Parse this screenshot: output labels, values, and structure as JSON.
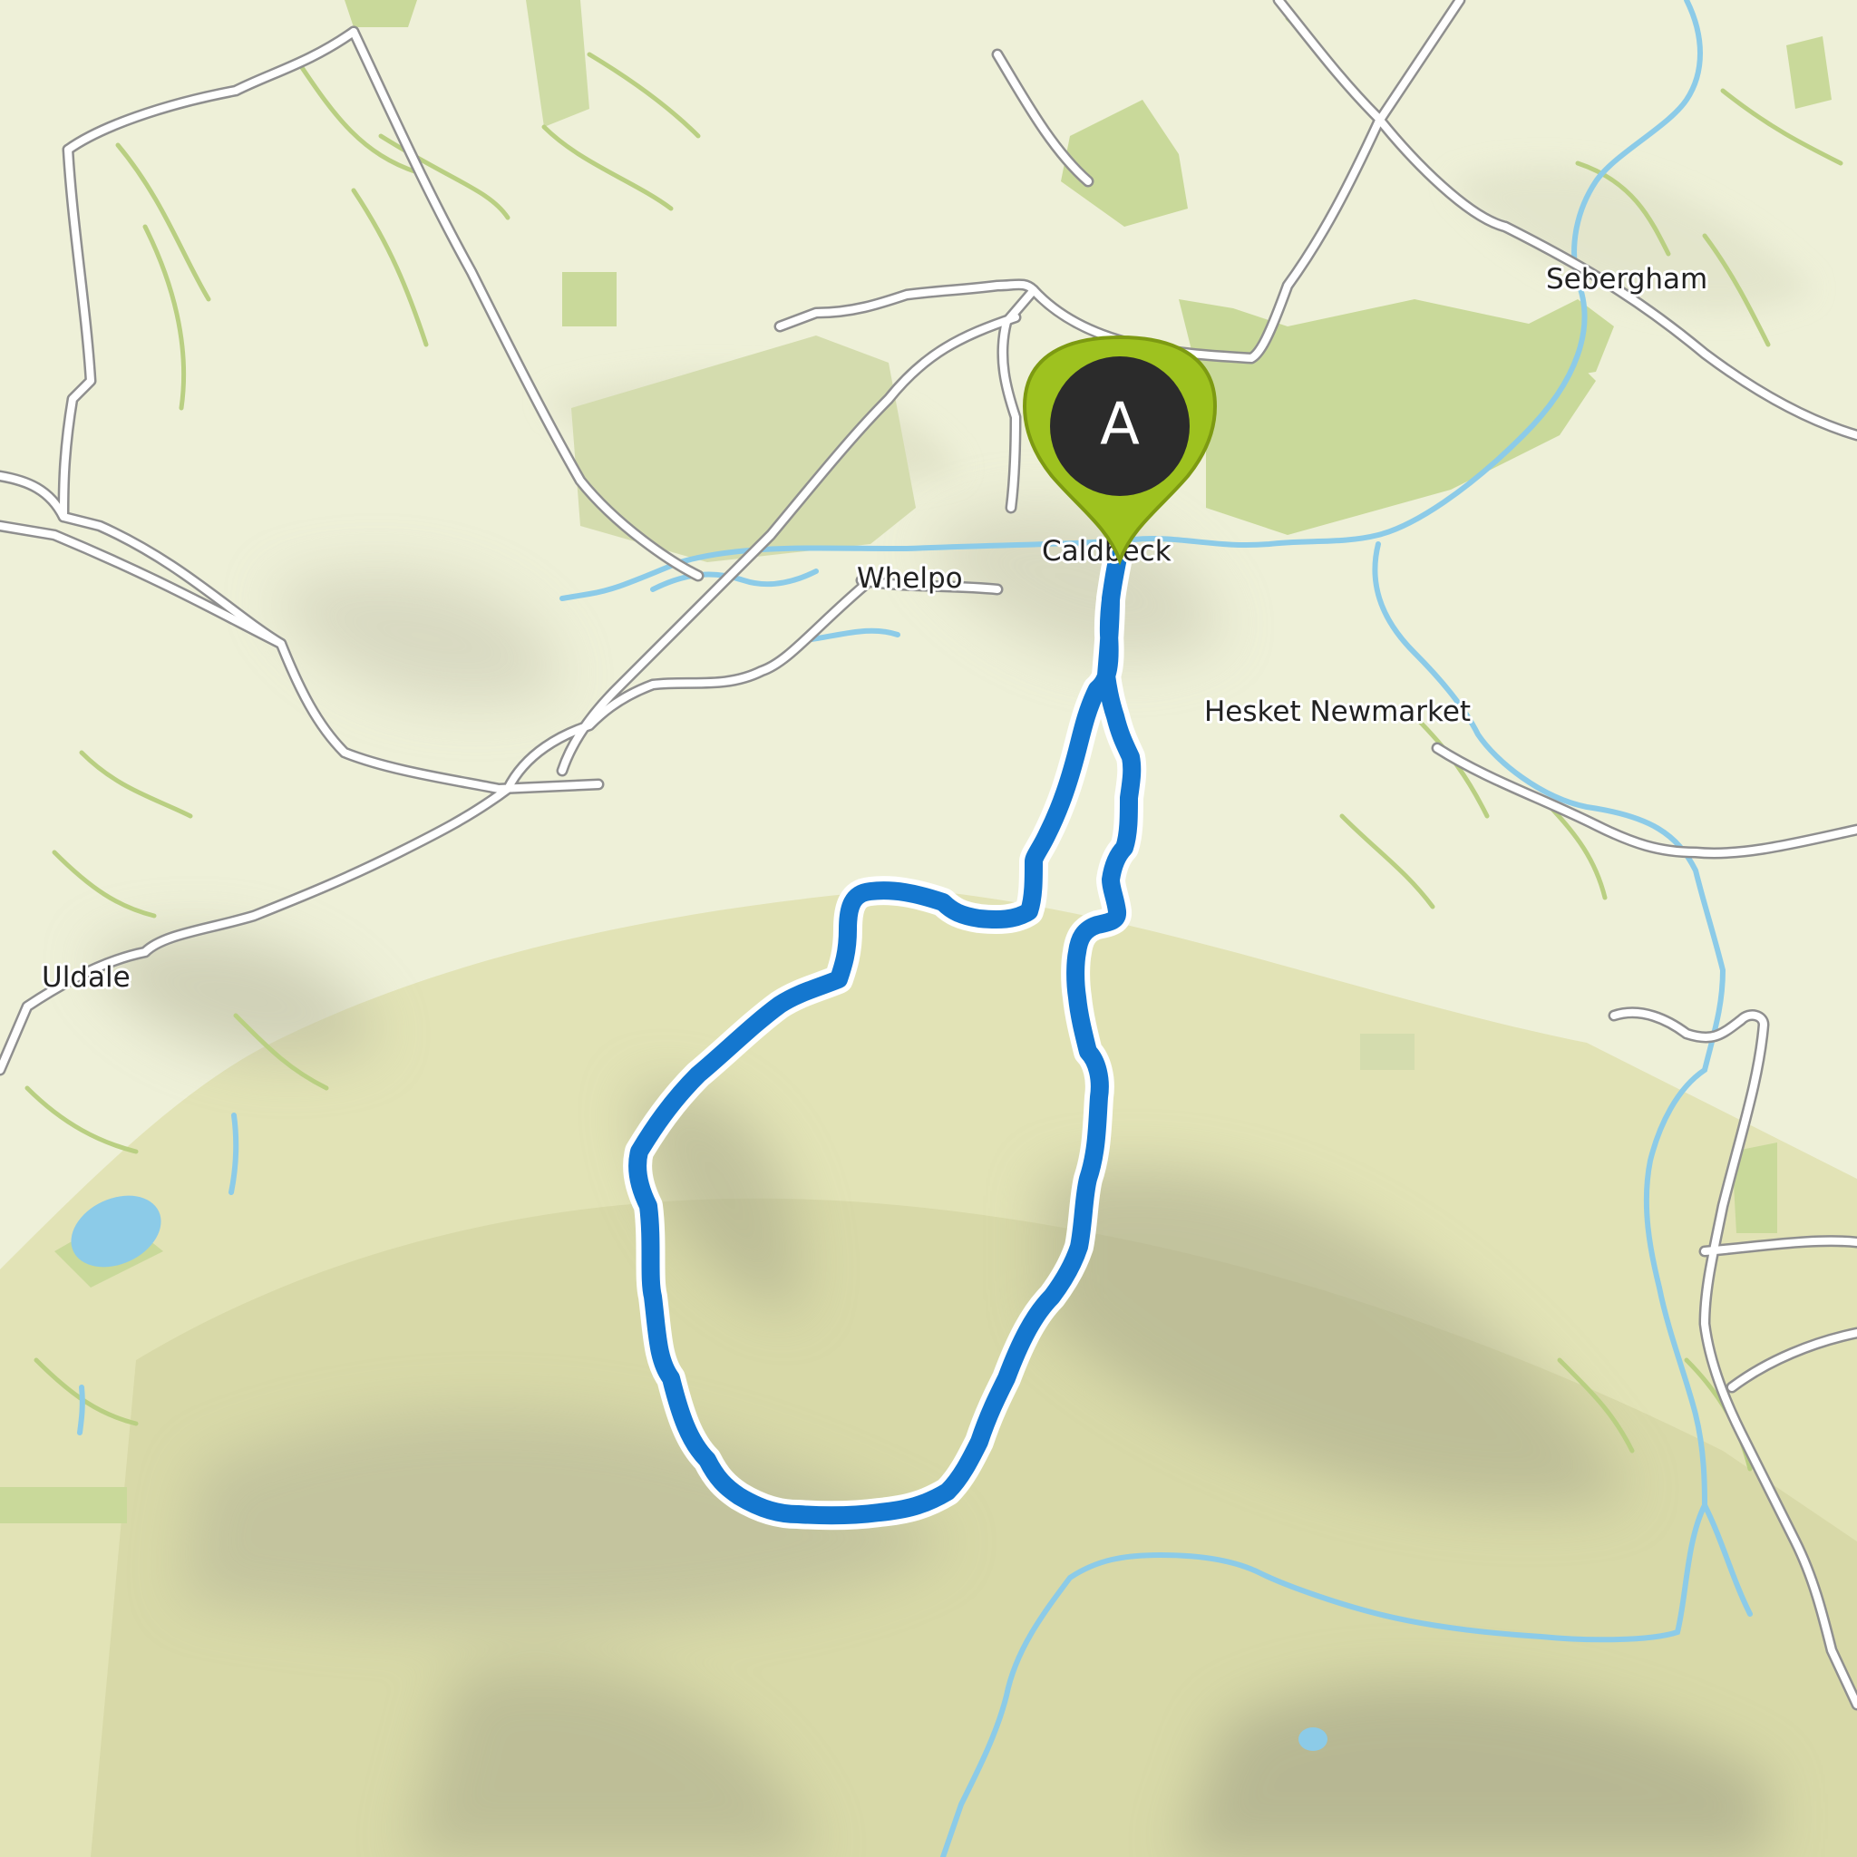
{
  "map": {
    "places": [
      {
        "id": "sebergham",
        "label": "Sebergham"
      },
      {
        "id": "caldbeck",
        "label": "Caldbeck"
      },
      {
        "id": "whelpo",
        "label": "Whelpo"
      },
      {
        "id": "hesket-newmarket",
        "label": "Hesket Newmarket"
      },
      {
        "id": "uldale",
        "label": "Uldale"
      }
    ],
    "start_marker": {
      "letter": "A",
      "color": "#9ec21f",
      "center_color": "#2b2b2b"
    },
    "route": {
      "color": "#1477cf",
      "outline": "#ffffff",
      "type": "loop"
    },
    "colors": {
      "background": "#eef0d8",
      "woodland": "#c9d99a",
      "field": "#d8e2b0",
      "roads": "#ffffff",
      "road_casing": "#8f8f8f",
      "water": "#8ccbe8",
      "fell": "#a9a98a"
    }
  }
}
